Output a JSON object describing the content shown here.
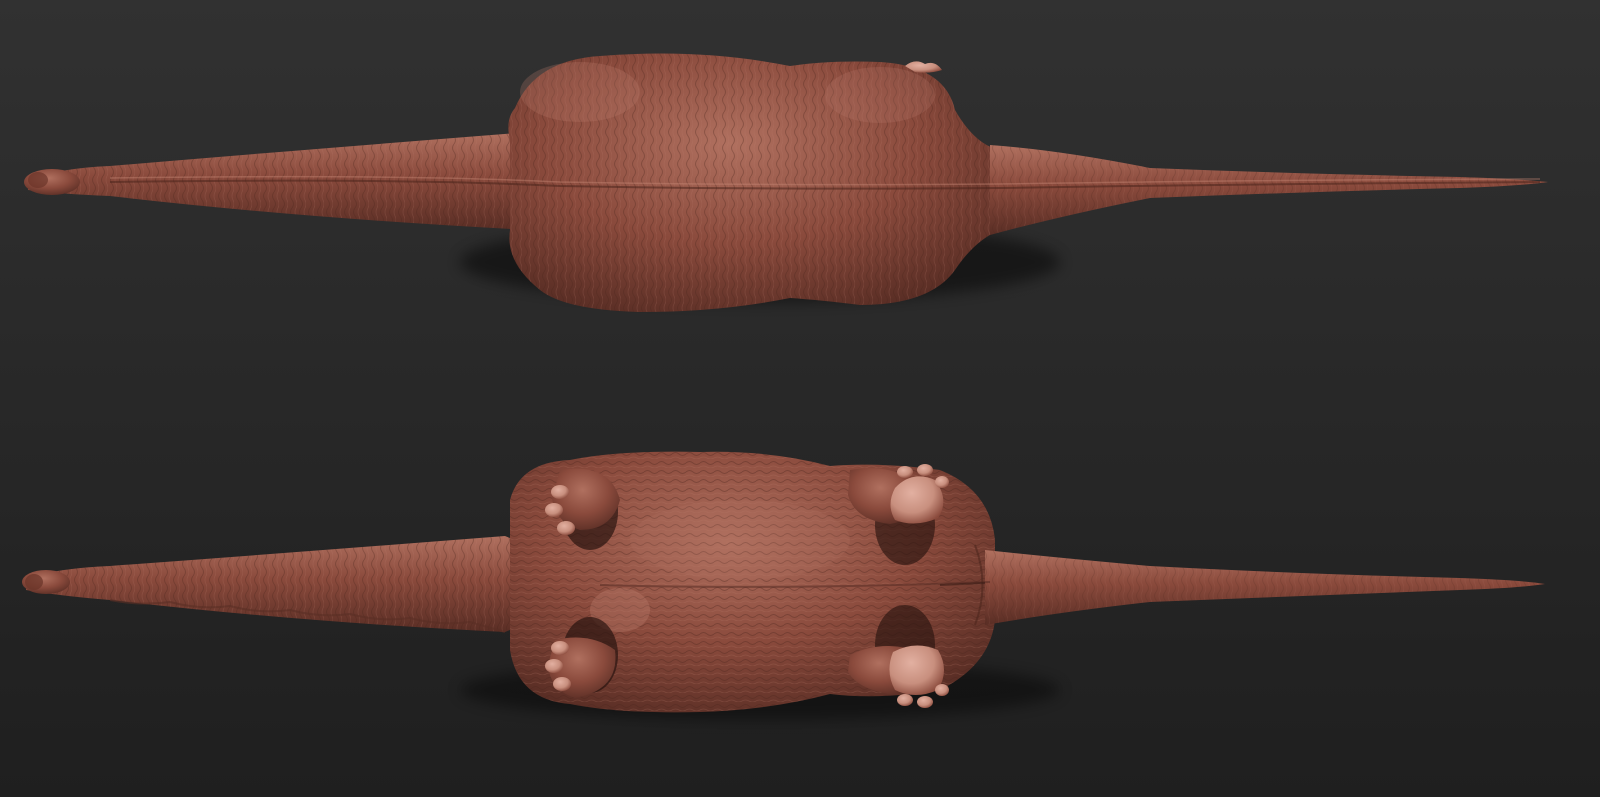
{
  "viewport": {
    "background_top": "#313131",
    "background_bottom": "#1f1f1f"
  },
  "material": {
    "base": "#8a4a3c",
    "light": "#b0705f",
    "dark": "#5a2e25",
    "claw": "#c88f7e"
  },
  "views": [
    {
      "name": "dorsal-view",
      "shows": "back",
      "limbs_visible": false
    },
    {
      "name": "ventral-view",
      "shows": "belly",
      "limbs_visible": true
    }
  ]
}
